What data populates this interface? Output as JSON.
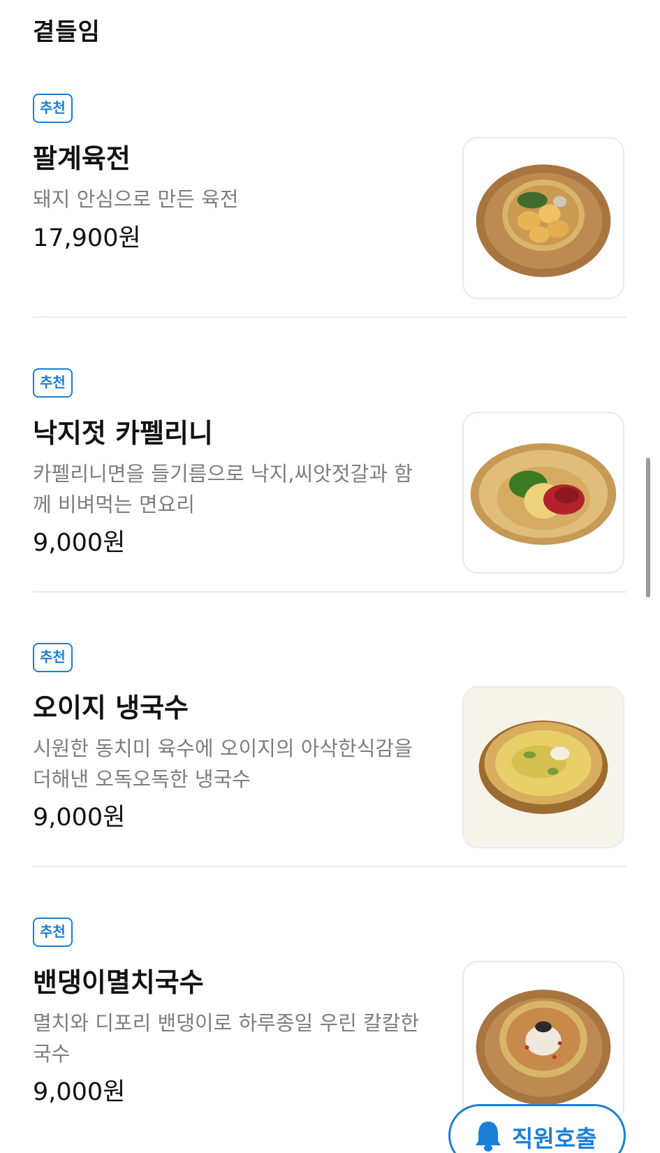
{
  "section": {
    "title": "곁들임"
  },
  "items": [
    {
      "badge": "추천",
      "name": "팔계육전",
      "desc": "돼지 안심으로 만든 육전",
      "price": "17,900원"
    },
    {
      "badge": "추천",
      "name": "낙지젓 카펠리니",
      "desc": "카펠리니면을 들기름으로 낙지,씨앗젓갈과 함께 비벼먹는 면요리",
      "price": "9,000원"
    },
    {
      "badge": "추천",
      "name": "오이지 냉국수",
      "desc": "시원한 동치미 육수에 오이지의 아삭한식감을 더해낸 오독오독한 냉국수",
      "price": "9,000원"
    },
    {
      "badge": "추천",
      "name": "밴댕이멸치국수",
      "desc": "멸치와 디포리 밴댕이로 하루종일 우린 칼칼한국수",
      "price": "9,000원"
    }
  ],
  "call_button": {
    "label": "직원호출",
    "icon": "bell-icon"
  },
  "colors": {
    "accent": "#1a7fd4",
    "muted_text": "#7d7d7d",
    "divider": "#e7ecf2"
  }
}
